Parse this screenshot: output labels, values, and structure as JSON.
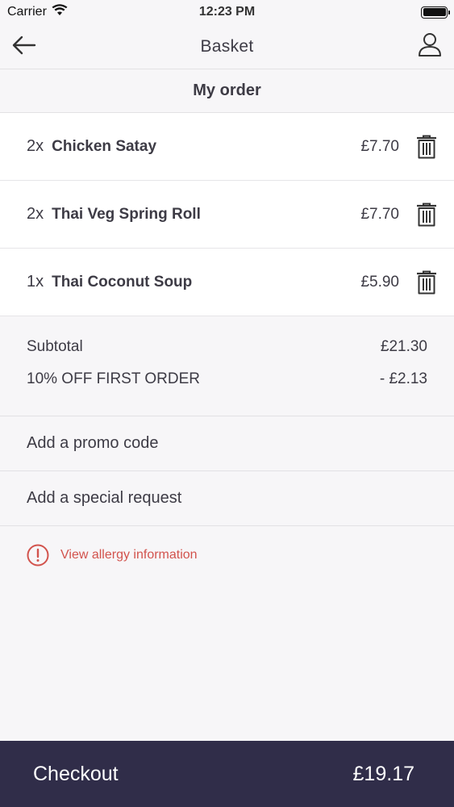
{
  "status_bar": {
    "carrier": "Carrier",
    "time": "12:23 PM"
  },
  "nav": {
    "title": "Basket",
    "back_icon": "arrow-left-icon",
    "profile_icon": "user-icon"
  },
  "order": {
    "section_title": "My order",
    "items": [
      {
        "qty": "2x",
        "name": "Chicken Satay",
        "price": "£7.70"
      },
      {
        "qty": "2x",
        "name": "Thai Veg Spring Roll",
        "price": "£7.70"
      },
      {
        "qty": "1x",
        "name": "Thai Coconut Soup",
        "price": "£5.90"
      }
    ]
  },
  "totals": {
    "subtotal_label": "Subtotal",
    "subtotal_value": "£21.30",
    "discount_label": "10% OFF FIRST ORDER",
    "discount_value": "- £2.13"
  },
  "links": {
    "promo": "Add a promo code",
    "special_request": "Add a special request",
    "allergy": "View allergy information"
  },
  "checkout": {
    "label": "Checkout",
    "total": "£19.17"
  },
  "colors": {
    "background": "#f7f6f8",
    "checkout_bar": "#302d49",
    "allergy_accent": "#d2534d",
    "text": "#3d3b45"
  }
}
